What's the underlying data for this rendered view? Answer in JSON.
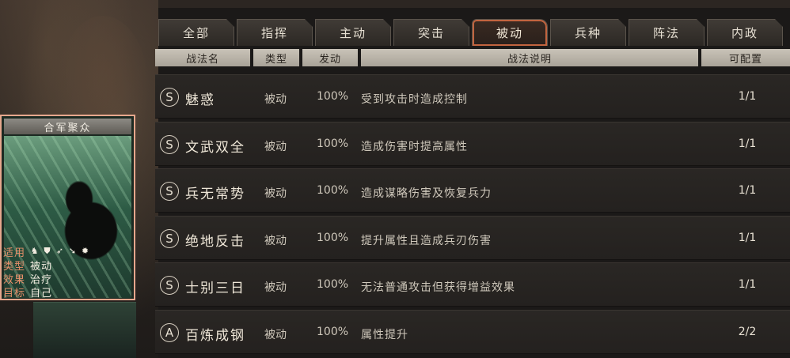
{
  "tabs": [
    {
      "label": "全部",
      "active": false
    },
    {
      "label": "指挥",
      "active": false
    },
    {
      "label": "主动",
      "active": false
    },
    {
      "label": "突击",
      "active": false
    },
    {
      "label": "被动",
      "active": true
    },
    {
      "label": "兵种",
      "active": false
    },
    {
      "label": "阵法",
      "active": false
    },
    {
      "label": "内政",
      "active": false
    }
  ],
  "columns": {
    "name": "战法名",
    "type": "类型",
    "rate": "发动",
    "desc": "战法说明",
    "config": "可配置"
  },
  "rows": [
    {
      "grade": "S",
      "name": "魅惑",
      "type": "被动",
      "rate": "100%",
      "desc": "受到攻击时造成控制",
      "config": "1/1"
    },
    {
      "grade": "S",
      "name": "文武双全",
      "type": "被动",
      "rate": "100%",
      "desc": "造成伤害时提高属性",
      "config": "1/1"
    },
    {
      "grade": "S",
      "name": "兵无常势",
      "type": "被动",
      "rate": "100%",
      "desc": "造成谋略伤害及恢复兵力",
      "config": "1/1"
    },
    {
      "grade": "S",
      "name": "绝地反击",
      "type": "被动",
      "rate": "100%",
      "desc": "提升属性且造成兵刃伤害",
      "config": "1/1"
    },
    {
      "grade": "S",
      "name": "士别三日",
      "type": "被动",
      "rate": "100%",
      "desc": "无法普通攻击但获得增益效果",
      "config": "1/1"
    },
    {
      "grade": "A",
      "name": "百炼成钢",
      "type": "被动",
      "rate": "100%",
      "desc": "属性提升",
      "config": "2/2"
    }
  ],
  "card": {
    "title": "合军聚众",
    "applicable_label": "适用",
    "type_label": "类型",
    "type_value": "被动",
    "effect_label": "效果",
    "effect_value": "治疗",
    "target_label": "目标",
    "target_value": "自己",
    "unit_icons": [
      "cavalry-icon",
      "shield-icon",
      "bow-icon",
      "spear-icon",
      "wheel-icon"
    ]
  },
  "colors": {
    "accent": "#c2643f",
    "card_border": "#e6a78d",
    "label_orange": "#e58f6a"
  }
}
